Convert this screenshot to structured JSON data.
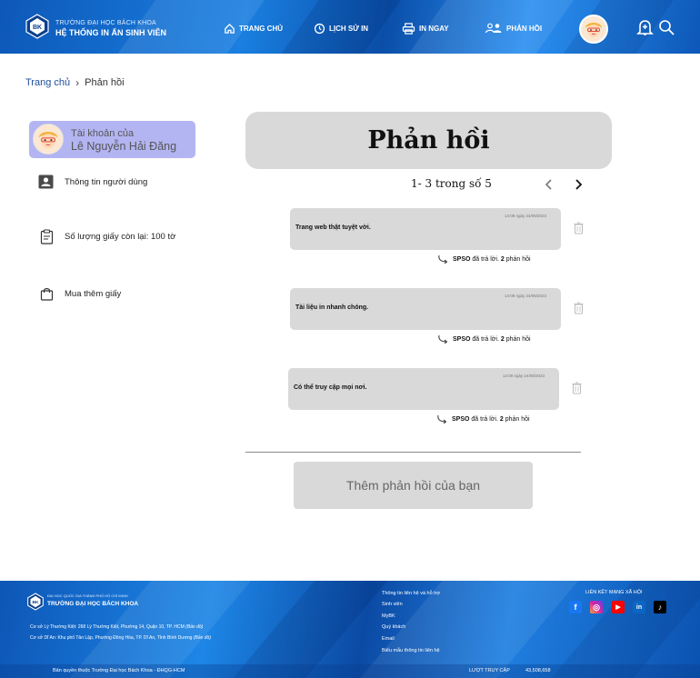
{
  "header": {
    "school_top": "TRƯỜNG ĐẠI HỌC BÁCH KHOA",
    "school_main": "HỆ THỐNG IN ẤN SINH VIÊN",
    "nav": [
      {
        "label": "TRANG CHỦ",
        "icon": "home-icon"
      },
      {
        "label": "LỊCH SỬ IN",
        "icon": "history-icon"
      },
      {
        "label": "IN NGAY",
        "icon": "printer-icon"
      },
      {
        "label": "PHẢN HỒI",
        "icon": "users-icon"
      }
    ],
    "logo_text": "BK"
  },
  "breadcrumb": {
    "home": "Trang chủ",
    "separator": "›",
    "current": "Phản hồi"
  },
  "sidebar": {
    "account_line1": "Tài khoản của",
    "account_name": "Lê Nguyễn Hải Đăng",
    "items": [
      {
        "label": "Thông tin người dùng",
        "icon": "user-card-icon"
      },
      {
        "label": "Số lượng giấy còn lại: 100 tờ",
        "icon": "clipboard-icon"
      },
      {
        "label": "Mua thêm giấy",
        "icon": "shopping-bag-icon"
      }
    ]
  },
  "main": {
    "title": "Phản hồi",
    "pager_text": "1- 3 trong số 5",
    "feedbacks": [
      {
        "time": "14:08 ngày 24/08/2023",
        "text": "Trang web thật tuyệt vời.",
        "reply_by": "SPSO",
        "reply_mid": " đã trả lời. ",
        "reply_count": "2",
        "reply_tail": " phản hồi"
      },
      {
        "time": "14:08 ngày 24/08/2023",
        "text": "Tài liệu in nhanh chóng.",
        "reply_by": "SPSO",
        "reply_mid": " đã trả lời. ",
        "reply_count": "2",
        "reply_tail": " phản hồi"
      },
      {
        "time": "14:08 ngày 24/08/2023",
        "text": "Có thể truy cập mọi nơi.",
        "reply_by": "SPSO",
        "reply_mid": " đã trả lời. ",
        "reply_count": "2",
        "reply_tail": " phản hồi"
      }
    ],
    "add_button": "Thêm phản hồi của bạn"
  },
  "footer": {
    "small": "ĐẠI HỌC QUỐC GIA THÀNH PHỐ HỒ CHÍ MINH",
    "school": "TRƯỜNG ĐẠI HỌC BÁCH KHOA",
    "addr1": "Cơ sở Lý Thường Kiệt: 268 Lý Thường Kiệt, Phường 14, Quận 10, TP. HCM",
    "addr1_map": "(Bản đồ)",
    "addr2": "Cơ sở Dĩ An: Khu phố Tân Lập, Phường Đông Hòa, TP. Dĩ An, Tỉnh Bình Dương",
    "addr2_map": "(Bản đồ)",
    "links": [
      "Thông tin liên hệ và hỗ trợ",
      "Sinh viên",
      "MyBK",
      "Quý khách",
      "Email",
      "Biểu mẫu thông tin liên hệ"
    ],
    "social_title": "LIÊN KẾT MẠNG XÃ HỘI",
    "social": [
      {
        "name": "facebook-icon",
        "glyph": "f",
        "color": "#1877f2"
      },
      {
        "name": "instagram-icon",
        "glyph": "◎",
        "color": "#d6249f"
      },
      {
        "name": "youtube-icon",
        "glyph": "▶",
        "color": "#ff0000"
      },
      {
        "name": "linkedin-icon",
        "glyph": "in",
        "color": "#0a66c2"
      },
      {
        "name": "tiktok-icon",
        "glyph": "♪",
        "color": "#000000"
      }
    ],
    "copyright": "Bản quyền thuộc Trường Đại học Bách Khoa - ĐHQG-HCM",
    "visits_label": "LƯỢT TRUY CẬP",
    "visits_count": "43,508,658"
  }
}
